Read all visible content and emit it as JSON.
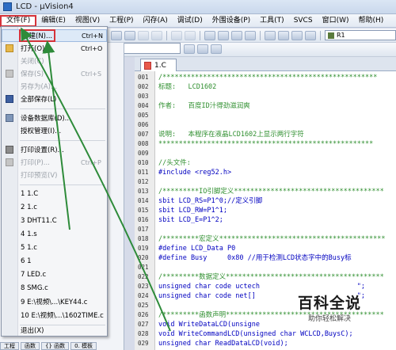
{
  "window": {
    "title": "LCD - µVision4"
  },
  "menubar": [
    "文件(F)",
    "编辑(E)",
    "视图(V)",
    "工程(P)",
    "闪存(A)",
    "调试(D)",
    "外围设备(P)",
    "工具(T)",
    "SVCS",
    "窗口(W)",
    "帮助(H)"
  ],
  "toolbar": {
    "target": "R1"
  },
  "editor": {
    "tab": "1.C",
    "lines": [
      {
        "n": "001",
        "t": "/*****************************************************"
      },
      {
        "n": "002",
        "t": "标题:   LCD1602"
      },
      {
        "n": "003",
        "t": ""
      },
      {
        "n": "004",
        "t": "作者:   百度ID汁得劲滋润爽"
      },
      {
        "n": "005",
        "t": ""
      },
      {
        "n": "006",
        "t": ""
      },
      {
        "n": "007",
        "t": "说明:   本程序在液晶LCD1602上显示两行字符"
      },
      {
        "n": "008",
        "t": "*****************************************************"
      },
      {
        "n": "009",
        "t": ""
      },
      {
        "n": "010",
        "t": "//头文件:"
      },
      {
        "n": "011",
        "t": "#include <reg52.h>"
      },
      {
        "n": "012",
        "t": ""
      },
      {
        "n": "013",
        "t": "/*********IO引脚定义*************************************"
      },
      {
        "n": "014",
        "t": "sbit LCD_RS=P1^0;//定义引脚"
      },
      {
        "n": "015",
        "t": "sbit LCD_RW=P1^1;"
      },
      {
        "n": "016",
        "t": "sbit LCD_E=P1^2;"
      },
      {
        "n": "017",
        "t": ""
      },
      {
        "n": "018",
        "t": "/*********宏定义*****************************************"
      },
      {
        "n": "019",
        "t": "#define LCD_Data P0"
      },
      {
        "n": "020",
        "t": "#define Busy     0x80 //用于检测LCD状态字中的Busy标"
      },
      {
        "n": "021",
        "t": ""
      },
      {
        "n": "022",
        "t": "/*********数据定义***************************************"
      },
      {
        "n": "023",
        "t": "unsigned char code uctech                        \";"
      },
      {
        "n": "024",
        "t": "unsigned char code net[]                         \";"
      },
      {
        "n": "025",
        "t": ""
      },
      {
        "n": "026",
        "t": "/*********函数声明***************************************"
      },
      {
        "n": "027",
        "t": "void WriteDataLCD(unsigne"
      },
      {
        "n": "028",
        "t": "void WriteCommandLCD(unsigned char WCLCD,BuysC);"
      },
      {
        "n": "029",
        "t": "unsigned char ReadDataLCD(void);"
      }
    ]
  },
  "file_menu": {
    "items": [
      {
        "label": "新建(N)...",
        "shortcut": "Ctrl+N",
        "icon": "new-file-icon"
      },
      {
        "label": "打开(O)...",
        "shortcut": "Ctrl+O",
        "icon": "open-folder-icon"
      },
      {
        "label": "关闭(C)",
        "shortcut": "",
        "icon": ""
      },
      {
        "label": "保存(S)",
        "shortcut": "Ctrl+S",
        "icon": "save-icon"
      },
      {
        "label": "另存为(A)...",
        "shortcut": "",
        "icon": ""
      },
      {
        "label": "全部保存(L)",
        "shortcut": "",
        "icon": "save-all-icon"
      },
      {
        "label": "设备数据库(D)...",
        "shortcut": "",
        "icon": "device-database-icon"
      },
      {
        "label": "授权管理(I)...",
        "shortcut": "",
        "icon": ""
      },
      {
        "label": "打印设置(R)...",
        "shortcut": "",
        "icon": "print-setup-icon"
      },
      {
        "label": "打印(P)...",
        "shortcut": "Ctrl+P",
        "icon": "print-icon"
      },
      {
        "label": "打印预览(V)",
        "shortcut": "",
        "icon": ""
      },
      {
        "label": "1 1.C",
        "shortcut": "",
        "icon": ""
      },
      {
        "label": "2 1.c",
        "shortcut": "",
        "icon": ""
      },
      {
        "label": "3 DHT11.C",
        "shortcut": "",
        "icon": ""
      },
      {
        "label": "4 1.s",
        "shortcut": "",
        "icon": ""
      },
      {
        "label": "5 1.c",
        "shortcut": "",
        "icon": ""
      },
      {
        "label": "6 1",
        "shortcut": "",
        "icon": ""
      },
      {
        "label": "7 LED.c",
        "shortcut": "",
        "icon": ""
      },
      {
        "label": "8 SMG.c",
        "shortcut": "",
        "icon": ""
      },
      {
        "label": "9 E:\\视频\\...\\KEY44.c",
        "shortcut": "",
        "icon": ""
      },
      {
        "label": "10 E:\\视频\\...\\1602TIME.c",
        "shortcut": "",
        "icon": ""
      },
      {
        "label": "退出(X)",
        "shortcut": "",
        "icon": ""
      }
    ]
  },
  "project_tabs": [
    "工程",
    "函数",
    "{} 函数",
    "0. 模板"
  ],
  "watermark": {
    "main": "百科全说",
    "sub": "助你轻松解决"
  },
  "colors": {
    "highlight_box": "#d5323a",
    "arrow": "#2e8b3a"
  }
}
